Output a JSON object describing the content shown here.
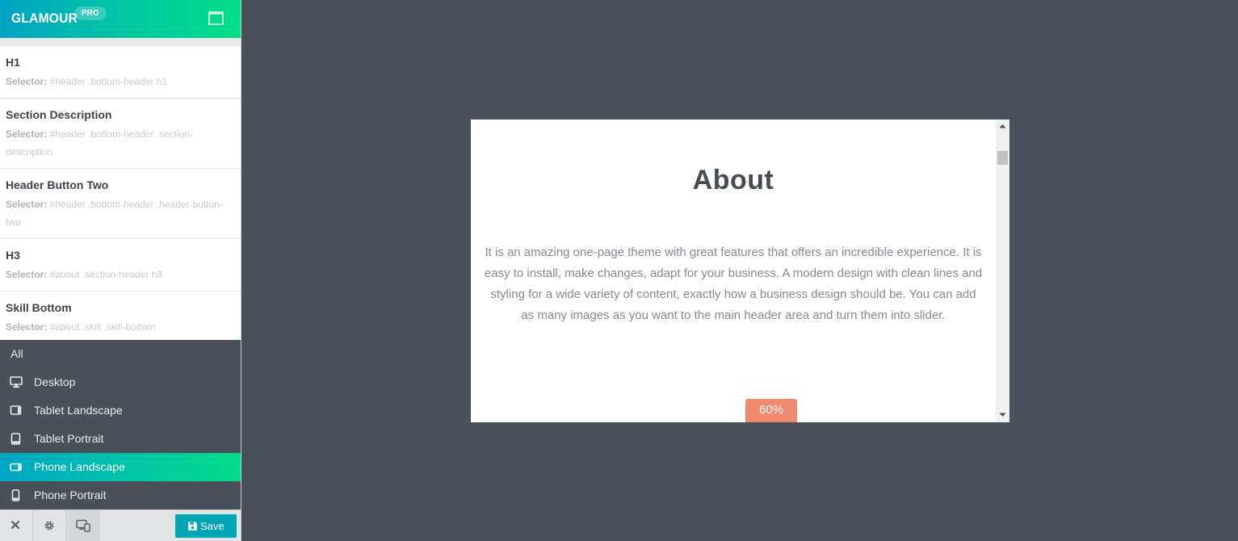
{
  "brand": {
    "name": "GLAMOUR",
    "badge": "PRO"
  },
  "selectors": [
    {
      "title": "H1",
      "label": "Selector:",
      "value": "#header .bottom-header h1"
    },
    {
      "title": "Section Description",
      "label": "Selector:",
      "value": "#header .bottom-header .section-description"
    },
    {
      "title": "Header Button Two",
      "label": "Selector:",
      "value": "#header .bottom-header .header-button-two"
    },
    {
      "title": "H3",
      "label": "Selector:",
      "value": "#about .section-header h3"
    },
    {
      "title": "Skill Bottom",
      "label": "Selector:",
      "value": "#about .skill .skill-bottom"
    }
  ],
  "devices": [
    {
      "label": "All",
      "icon": "none"
    },
    {
      "label": "Desktop",
      "icon": "desktop-icon"
    },
    {
      "label": "Tablet Landscape",
      "icon": "tablet-landscape-icon"
    },
    {
      "label": "Tablet Portrait",
      "icon": "tablet-portrait-icon"
    },
    {
      "label": "Phone Landscape",
      "icon": "phone-landscape-icon",
      "active": true
    },
    {
      "label": "Phone Portrait",
      "icon": "phone-portrait-icon"
    }
  ],
  "footer": {
    "save_label": "Save"
  },
  "preview": {
    "title": "About",
    "text": "It is an amazing one-page theme with great features that offers an incredible experience. It is easy to install, make changes, adapt for your business. A modern design with clean lines and styling for a wide variety of content, exactly how a business design should be. You can add as many images as you want to the main header area and turn them into slider.",
    "skill_value": "60%"
  },
  "colors": {
    "accent_start": "#00a3c4",
    "accent_end": "#00de87",
    "canvas_bg": "#495059",
    "device_menu_bg": "#4a5058",
    "save_button": "#00a6b4",
    "skill_badge": "#f08a6e"
  }
}
